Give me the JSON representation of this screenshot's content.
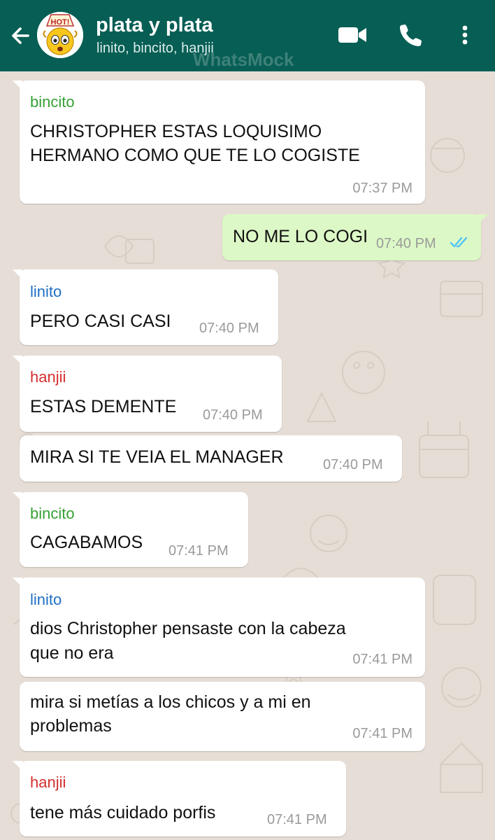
{
  "header": {
    "title": "plata y plata",
    "members": "linito, bincito, hanjii",
    "watermark": "WhatsMock",
    "avatar_badge": "HOT!"
  },
  "colors": {
    "header_bg": "#075e54",
    "chat_bg": "#e6ded6",
    "incoming_bubble": "#ffffff",
    "outgoing_bubble": "#dcf8c6",
    "read_ticks": "#4fc3f7",
    "sender_bincito": "#35a134",
    "sender_linito": "#1f6fc5",
    "sender_hanjii": "#d32f2f"
  },
  "icons": [
    "back-arrow-icon",
    "video-call-icon",
    "phone-icon",
    "more-vert-icon",
    "double-check-icon"
  ],
  "messages": [
    {
      "sender": "bincito",
      "lines": [
        "CHRISTOPHER ESTAS LOQUISIMO",
        "HERMANO COMO QUE TE LO COGISTE"
      ],
      "time": "07:37 PM"
    },
    {
      "sender": "",
      "lines": [
        "NO ME LO COGI"
      ],
      "time": "07:40 PM",
      "outgoing": true,
      "status": "read"
    },
    {
      "sender": "linito",
      "lines": [
        "PERO CASI CASI"
      ],
      "time": "07:40 PM"
    },
    {
      "sender": "hanjii",
      "lines": [
        "ESTAS DEMENTE"
      ],
      "time": "07:40 PM"
    },
    {
      "sender": "",
      "lines": [
        "MIRA SI TE VEIA EL MANAGER"
      ],
      "time": "07:40 PM"
    },
    {
      "sender": "bincito",
      "lines": [
        "CAGABAMOS"
      ],
      "time": "07:41 PM"
    },
    {
      "sender": "linito",
      "lines": [
        "dios Christopher pensaste con la cabeza",
        "que no era"
      ],
      "time": "07:41 PM"
    },
    {
      "sender": "",
      "lines": [
        "mira si metías a los chicos y a mi en",
        "problemas"
      ],
      "time": "07:41 PM"
    },
    {
      "sender": "hanjii",
      "lines": [
        "tene más cuidado porfis"
      ],
      "time": "07:41 PM"
    }
  ]
}
